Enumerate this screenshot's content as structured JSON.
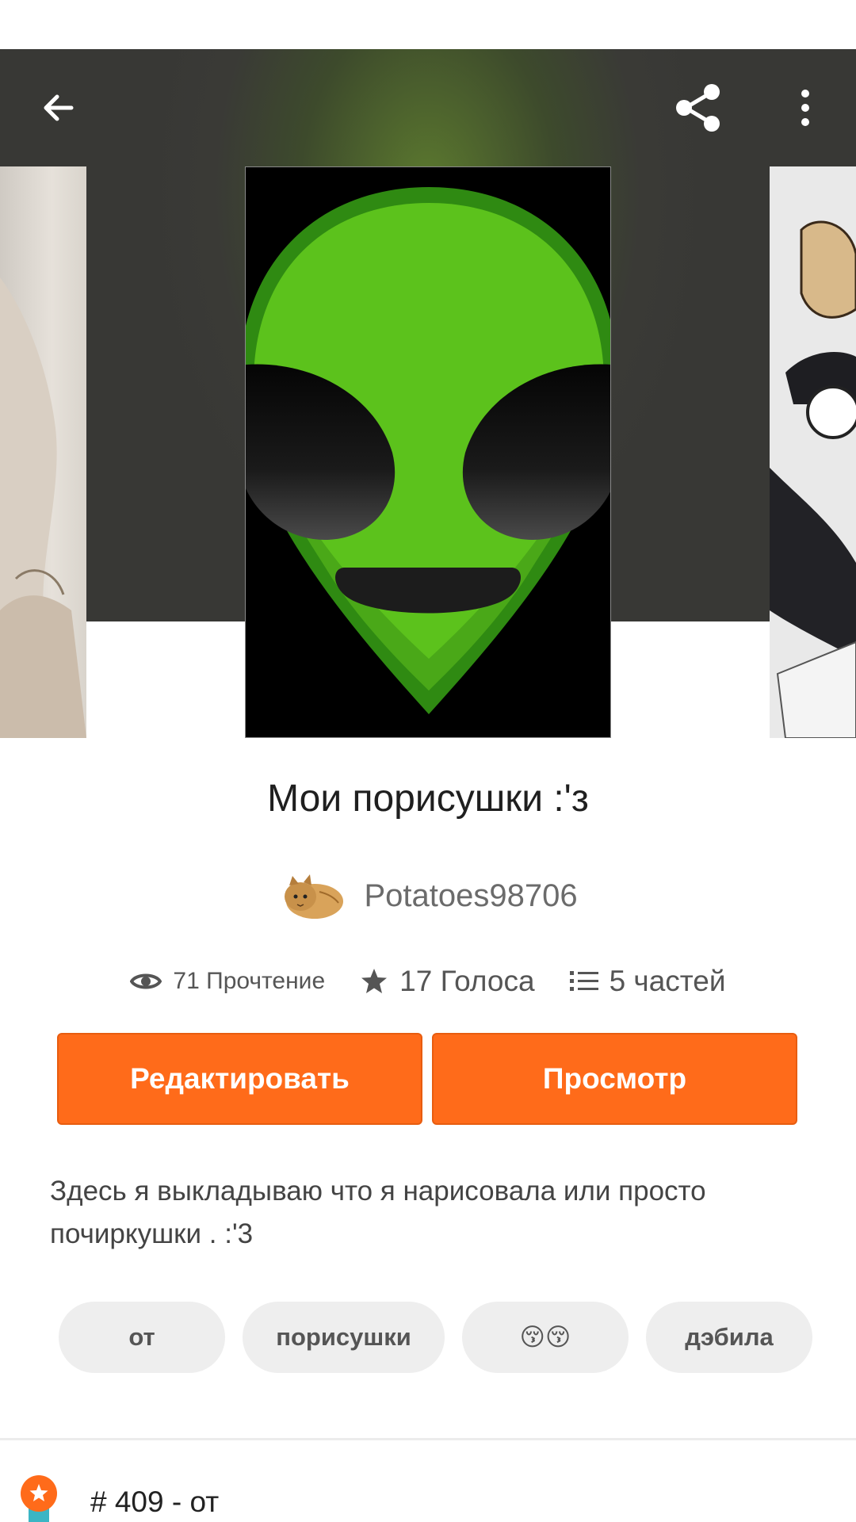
{
  "toolbar": {
    "back_icon": "arrow-left-icon",
    "share_icon": "share-icon",
    "more_icon": "more-vert-icon"
  },
  "story": {
    "title": "Мои порисушки :'з",
    "author": "Potatoes98706",
    "stats": {
      "reads": "71 Прочтение",
      "votes": "17 Голоса",
      "parts": "5 частей"
    },
    "description": "Здесь я выкладываю что я нарисовала или просто почиркушки . :'3"
  },
  "actions": {
    "edit_label": "Редактировать",
    "view_label": "Просмотр"
  },
  "tags": [
    "от",
    "порисушки",
    "😚😚",
    "дэбила"
  ],
  "rank": {
    "text": "# 409 - от"
  },
  "colors": {
    "accent": "#ff6b1a",
    "alien_green": "#5fc41e",
    "tag_bg": "#eeeeee"
  }
}
